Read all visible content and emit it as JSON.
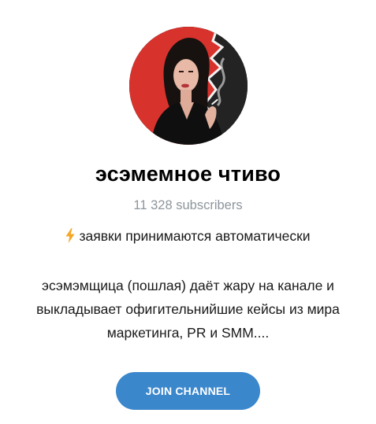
{
  "channel": {
    "name": "эсэмемное чтиво",
    "subscribers": "11 328 subscribers",
    "status_icon": "lightning-bolt-icon",
    "status_text": "заявки принимаются автоматически",
    "description_lines": [
      "эсэмэмщица (пошлая) даёт жару на канале и",
      "выкладывает офигительнийшие кейсы из мира",
      "маркетинга, PR и SMM...."
    ]
  },
  "actions": {
    "join_label": "JOIN CHANNEL"
  },
  "colors": {
    "accent": "#3b87cc",
    "muted_text": "#8e959c",
    "bolt": "#f5a623"
  }
}
